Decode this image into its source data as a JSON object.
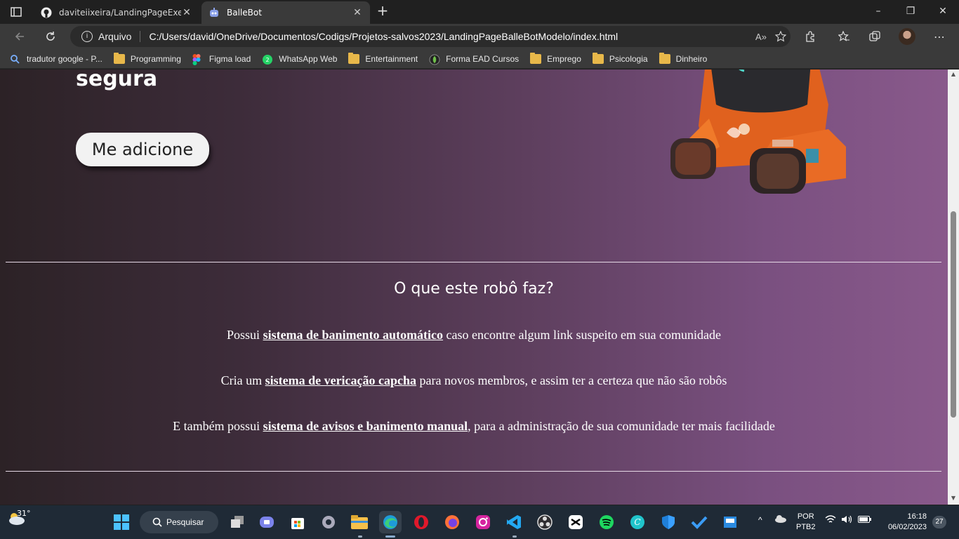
{
  "browser": {
    "tabs": [
      {
        "title": "daviteiixeira/LandingPageExercise",
        "close": "✕"
      },
      {
        "title": "BalleBot",
        "close": "✕"
      }
    ],
    "new_tab": "+",
    "window_controls": {
      "minimize": "–",
      "maximize": "❐",
      "close": "✕"
    },
    "address": {
      "scheme_label": "Arquivo",
      "url": "C:/Users/david/OneDrive/Documentos/Codigs/Projetos-salvos2023/LandingPageBalleBotModelo/index.html",
      "read_aloud": "A»"
    },
    "bookmarks": [
      {
        "label": "tradutor google - P...",
        "icon": "search-icon"
      },
      {
        "label": "Programming",
        "icon": "folder-icon"
      },
      {
        "label": "Figma load",
        "icon": "figma-icon"
      },
      {
        "label": "WhatsApp Web",
        "icon": "whatsapp-icon"
      },
      {
        "label": "Entertainment",
        "icon": "folder-icon"
      },
      {
        "label": "Forma EAD Cursos",
        "icon": "leaf-icon"
      },
      {
        "label": "Emprego",
        "icon": "folder-icon"
      },
      {
        "label": "Psicologia",
        "icon": "folder-icon"
      },
      {
        "label": "Dinheiro",
        "icon": "folder-icon"
      }
    ]
  },
  "page": {
    "hero_text": "segura",
    "add_button": "Me adicione",
    "section_title": "O que este robô faz?",
    "features": [
      {
        "pre": "Possui ",
        "bold": "sistema de banimento automático",
        "post": " caso encontre algum link suspeito em sua comunidade"
      },
      {
        "pre": "Cria um ",
        "bold": "sistema de vericação capcha",
        "post": " para novos membros, e assim ter a certeza que não são robôs"
      },
      {
        "pre": "E também possui ",
        "bold": "sistema de avisos e banimento manual",
        "post": ", para a administração de sua comunidade ter mais facilidade"
      }
    ]
  },
  "taskbar": {
    "weather": "31°",
    "search": "Pesquisar",
    "language": "POR",
    "layout": "PTB2",
    "time": "16:18",
    "date": "06/02/2023",
    "notifications": "27"
  }
}
